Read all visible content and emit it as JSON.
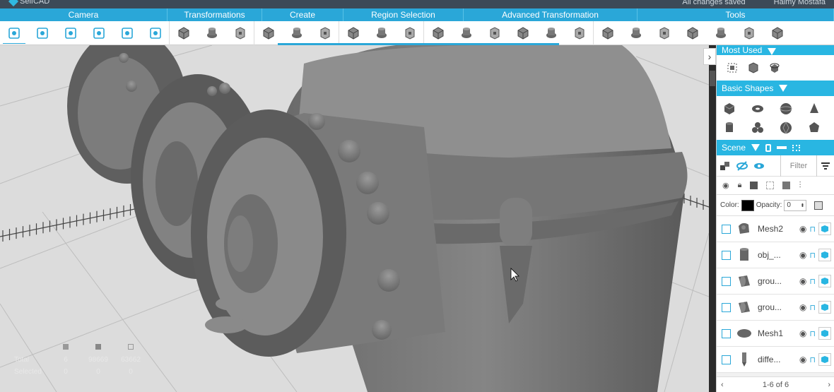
{
  "app": {
    "logo_text": "SelfCAD",
    "top_right_1": "All changes saved",
    "top_right_2": "Haimy Mostafa"
  },
  "menu": [
    {
      "label": "Camera",
      "width": 237
    },
    {
      "label": "Transformations",
      "width": 134
    },
    {
      "label": "Create",
      "width": 115
    },
    {
      "label": "Region Selection",
      "width": 170
    },
    {
      "label": "Advanced Transformation",
      "width": 246
    },
    {
      "label": "Tools",
      "width": 278
    }
  ],
  "toolbar_icons": [
    "camera-reset-icon",
    "zoom-fit-icon",
    "pan-icon",
    "rotate-view-icon",
    "camera-settings-icon",
    "camera-view-icon",
    "move-icon",
    "scale-icon",
    "rotate-icon",
    "cube-create-icon",
    "hat-shape-icon",
    "box-create-icon",
    "select-face-icon",
    "select-edge-icon",
    "select-vertex-icon",
    "solidify-icon",
    "stitch-icon",
    "extrude-icon",
    "taper-icon",
    "twist-icon",
    "bend-icon",
    "mirror-icon",
    "array-icon",
    "group-icon",
    "sphere-tool-icon",
    "hollow-icon",
    "slice-icon",
    "repair-icon"
  ],
  "stats": {
    "header_icons": [
      "mesh-icon",
      "polygon-icon",
      "vertex-icon"
    ],
    "total_label": "Total",
    "total_values": [
      "6",
      "98669",
      "63662"
    ],
    "selected_label": "Selected",
    "selected_values": [
      "0",
      "0",
      "0"
    ]
  },
  "sidebar": {
    "most_used": "Most Used",
    "basic_shapes": "Basic Shapes",
    "scene": "Scene",
    "filter_placeholder": "Filter",
    "color_label": "Color:",
    "color_value": "#000000",
    "opacity_label": "Opacity:",
    "opacity_value": "0",
    "objects": [
      {
        "name": "Mesh2",
        "thumb": "mesh-shape"
      },
      {
        "name": "obj_...",
        "thumb": "cylinder-shape"
      },
      {
        "name": "grou...",
        "thumb": "pipe-shape"
      },
      {
        "name": "grou...",
        "thumb": "pipe-shape"
      },
      {
        "name": "Mesh1",
        "thumb": "disc-shape"
      },
      {
        "name": "diffe...",
        "thumb": "pin-shape"
      }
    ],
    "pager": "1-6 of 6"
  },
  "colors": {
    "accent": "#2aa7d8",
    "header": "#29b6e2",
    "viewport": "#d8d8d8",
    "model": "#7d7d7d"
  }
}
